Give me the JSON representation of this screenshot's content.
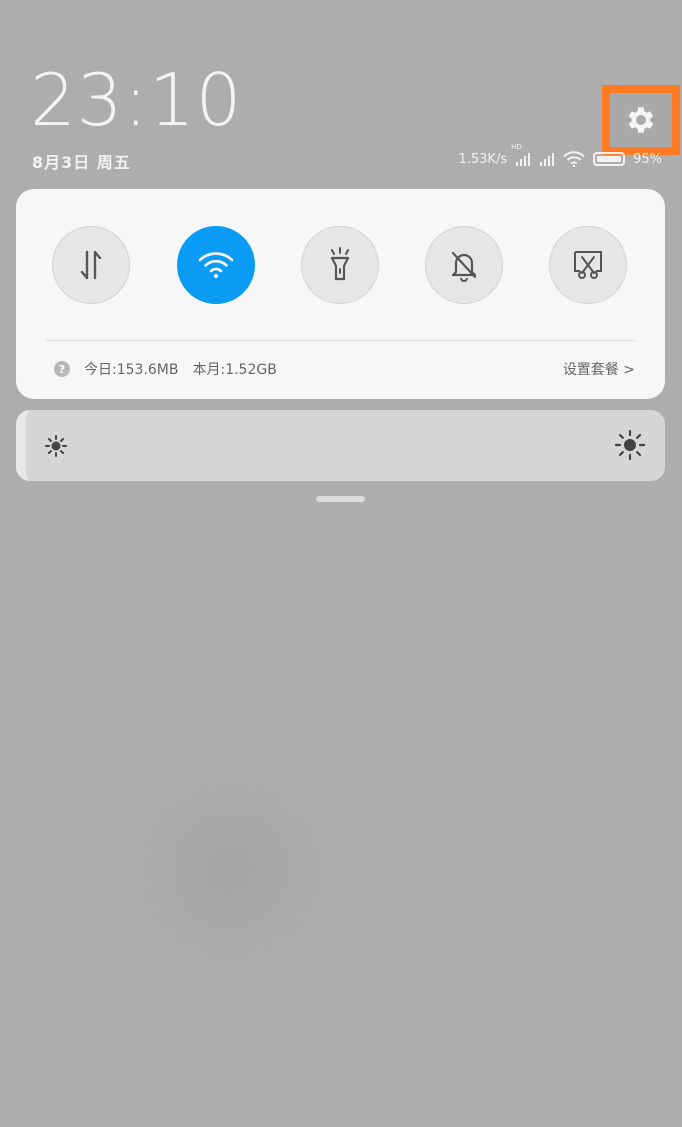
{
  "clock": {
    "time": "23:10",
    "date": "8月3日 周五"
  },
  "status_bar": {
    "network_speed": "1.53K/s",
    "hd_label": "HD",
    "battery_percent": "95%"
  },
  "quick_toggles": [
    {
      "name": "mobile-data",
      "icon": "data-arrows-icon",
      "active": false
    },
    {
      "name": "wifi",
      "icon": "wifi-icon",
      "active": true
    },
    {
      "name": "flashlight",
      "icon": "flashlight-icon",
      "active": false
    },
    {
      "name": "mute",
      "icon": "bell-off-icon",
      "active": false
    },
    {
      "name": "screenshot",
      "icon": "scissors-icon",
      "active": false
    }
  ],
  "data_usage": {
    "today": "今日:153.6MB",
    "month": "本月:1.52GB",
    "plan_link": "设置套餐 >"
  },
  "colors": {
    "active_toggle": "#0a9cf5",
    "highlight": "#ff7a22",
    "panel": "#f7f7f7",
    "backdrop": "#adadad"
  }
}
